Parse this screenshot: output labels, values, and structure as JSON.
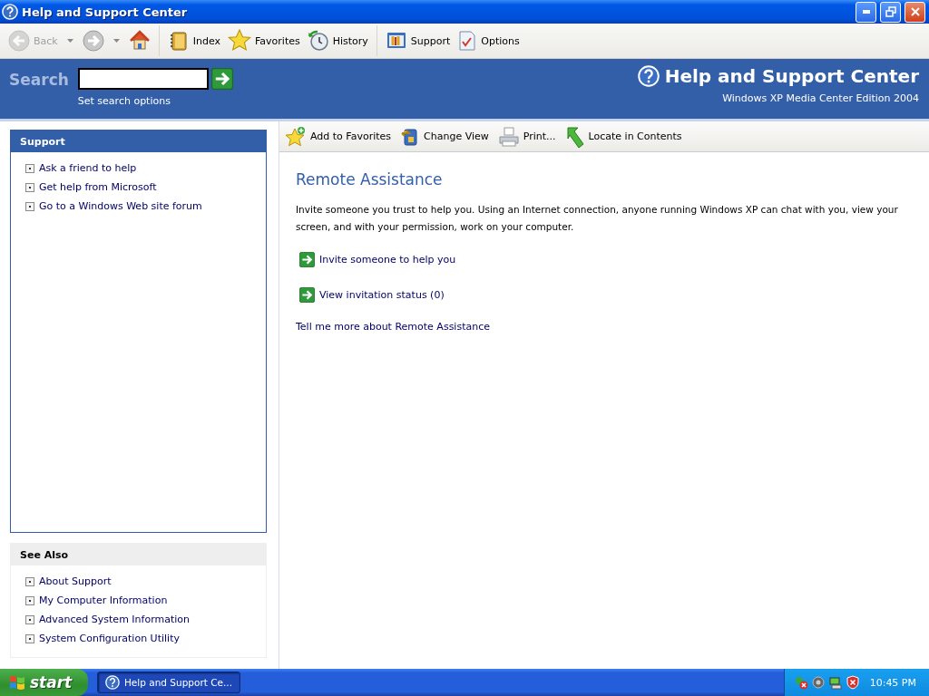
{
  "window": {
    "title": "Help and Support Center"
  },
  "toolbar": {
    "buttons": [
      {
        "kind": "back",
        "label": "Back",
        "disabled": true
      },
      {
        "kind": "forward"
      },
      {
        "kind": "home"
      },
      {
        "kind": "button",
        "label": "Index"
      },
      {
        "kind": "button",
        "label": "Favorites"
      },
      {
        "kind": "button",
        "label": "History"
      },
      {
        "kind": "button",
        "label": "Support"
      },
      {
        "kind": "button",
        "label": "Options"
      }
    ]
  },
  "search": {
    "label": "Search",
    "options_link": "Set search options"
  },
  "banner": {
    "title": "Help and Support Center",
    "edition": "Windows XP Media Center Edition 2004"
  },
  "sidebar": {
    "panels": [
      {
        "kind": "primary",
        "title": "Support",
        "items": [
          "Ask a friend to help",
          "Get help from Microsoft",
          "Go to a Windows Web site forum"
        ]
      },
      {
        "kind": "secondary",
        "title": "See Also",
        "items": [
          "About Support",
          "My Computer Information",
          "Advanced System Information",
          "System Configuration Utility"
        ]
      }
    ]
  },
  "content_toolbar": [
    {
      "label": "Add to Favorites"
    },
    {
      "label": "Change View"
    },
    {
      "label": "Print..."
    },
    {
      "label": "Locate in Contents"
    }
  ],
  "content": {
    "heading": "Remote Assistance",
    "intro": "Invite someone you trust to help you. Using an Internet connection, anyone running Windows XP can chat with you, view your screen, and with your permission, work on your computer.",
    "actions": [
      "Invite someone to help you",
      "View invitation status (0)"
    ],
    "more_link": "Tell me more about Remote Assistance"
  },
  "taskbar": {
    "start": "start",
    "tasks": [
      {
        "label": "Help and Support Ce...",
        "selected": true
      }
    ],
    "clock": "10:45 PM"
  }
}
